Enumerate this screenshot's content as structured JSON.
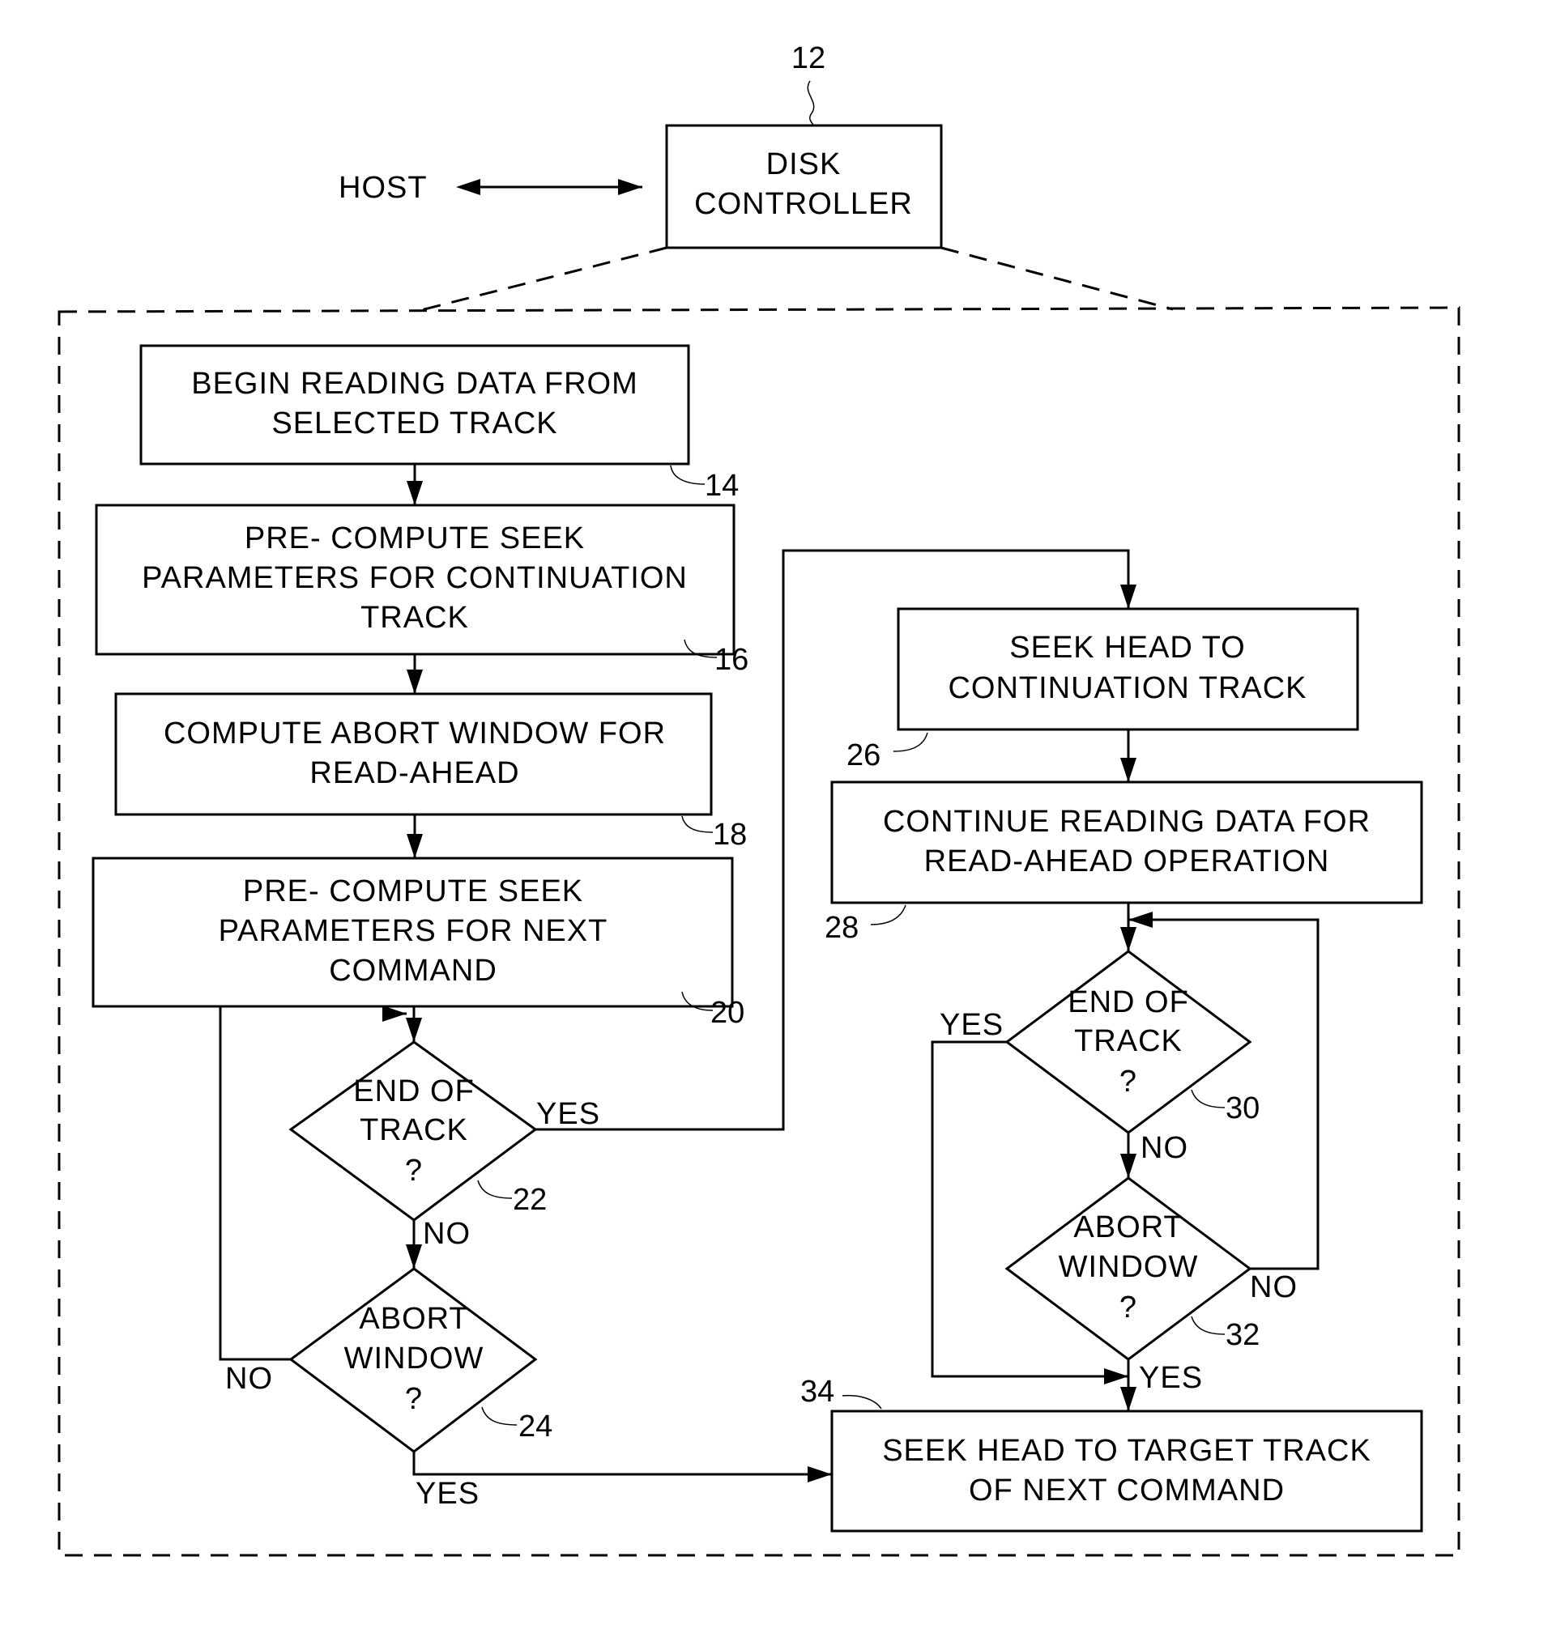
{
  "diagram": {
    "host_label": "HOST",
    "controller": {
      "ref": "12",
      "lines": [
        "DISK",
        "CONTROLLER"
      ]
    },
    "steps": {
      "s14": {
        "ref": "14",
        "lines": [
          "BEGIN READING DATA FROM",
          "SELECTED TRACK"
        ]
      },
      "s16": {
        "ref": "16",
        "lines": [
          "PRE- COMPUTE SEEK",
          "PARAMETERS FOR CONTINUATION",
          "TRACK"
        ]
      },
      "s18": {
        "ref": "18",
        "lines": [
          "COMPUTE ABORT WINDOW FOR",
          "READ-AHEAD"
        ]
      },
      "s20": {
        "ref": "20",
        "lines": [
          "PRE- COMPUTE SEEK",
          "PARAMETERS FOR NEXT",
          "COMMAND"
        ]
      },
      "d22": {
        "ref": "22",
        "lines": [
          "END OF",
          "TRACK",
          "?"
        ]
      },
      "d24": {
        "ref": "24",
        "lines": [
          "ABORT",
          "WINDOW",
          "?"
        ]
      },
      "s26": {
        "ref": "26",
        "lines": [
          "SEEK HEAD TO",
          "CONTINUATION TRACK"
        ]
      },
      "s28": {
        "ref": "28",
        "lines": [
          "CONTINUE READING DATA FOR",
          "READ-AHEAD OPERATION"
        ]
      },
      "d30": {
        "ref": "30",
        "lines": [
          "END OF",
          "TRACK",
          "?"
        ]
      },
      "d32": {
        "ref": "32",
        "lines": [
          "ABORT",
          "WINDOW",
          "?"
        ]
      },
      "s34": {
        "ref": "34",
        "lines": [
          "SEEK HEAD TO TARGET TRACK",
          "OF NEXT COMMAND"
        ]
      }
    },
    "edge_labels": {
      "d22_yes": "YES",
      "d22_no": "NO",
      "d24_no": "NO",
      "d24_yes": "YES",
      "d30_yes": "YES",
      "d30_no": "NO",
      "d32_no": "NO",
      "d32_yes": "YES"
    }
  }
}
